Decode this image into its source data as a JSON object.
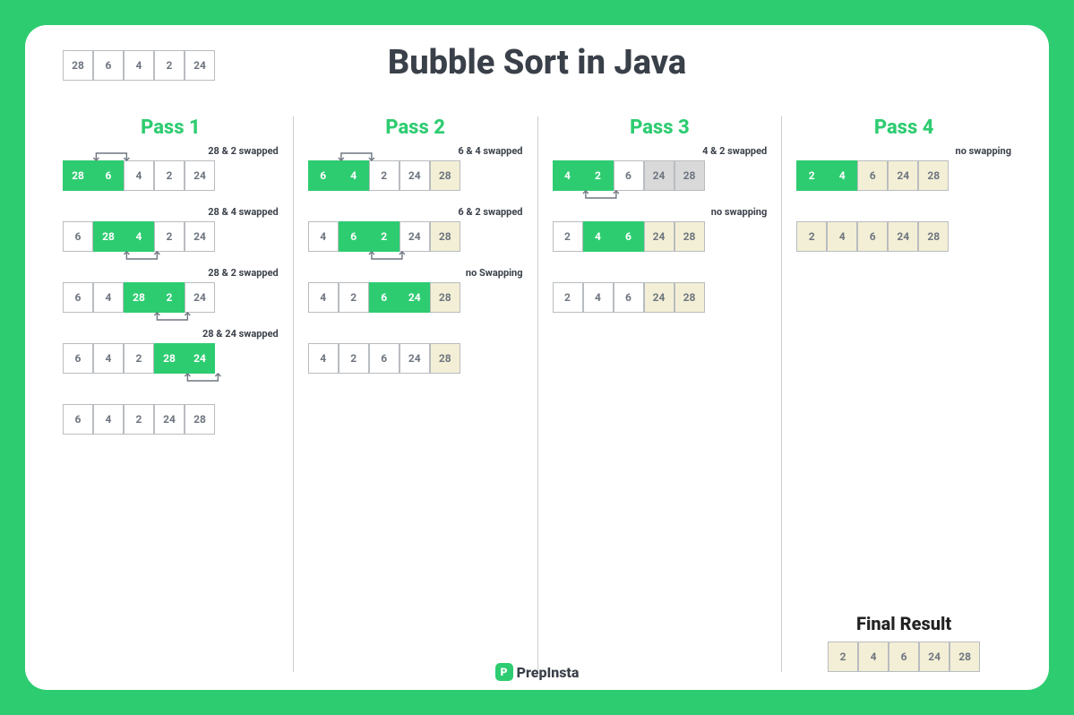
{
  "title": "Bubble Sort in Java",
  "brand": "PrepInsta",
  "colors": {
    "accent": "#2ecc71",
    "done": "#f3efd6",
    "gray": "#d9d9d9"
  },
  "initial": {
    "cells": [
      {
        "v": "28"
      },
      {
        "v": "6"
      },
      {
        "v": "4"
      },
      {
        "v": "2"
      },
      {
        "v": "24"
      }
    ]
  },
  "final_title": "Final Result",
  "final": {
    "cells": [
      {
        "v": "2",
        "s": "done"
      },
      {
        "v": "4",
        "s": "done"
      },
      {
        "v": "6",
        "s": "done"
      },
      {
        "v": "24",
        "s": "done"
      },
      {
        "v": "28",
        "s": "done"
      }
    ]
  },
  "passes": [
    {
      "title": "Pass 1",
      "steps": [
        {
          "label": "28 & 2 swapped",
          "cells": [
            {
              "v": "28",
              "s": "hl"
            },
            {
              "v": "6",
              "s": "hl"
            },
            {
              "v": "4"
            },
            {
              "v": "2"
            },
            {
              "v": "24"
            }
          ],
          "swap": [
            0,
            1
          ],
          "arrow": "top"
        },
        {
          "label": "28 & 4 swapped",
          "cells": [
            {
              "v": "6"
            },
            {
              "v": "28",
              "s": "hl"
            },
            {
              "v": "4",
              "s": "hl"
            },
            {
              "v": "2"
            },
            {
              "v": "24"
            }
          ],
          "swap": [
            1,
            2
          ],
          "arrow": "bottom"
        },
        {
          "label": "28 & 2 swapped",
          "cells": [
            {
              "v": "6"
            },
            {
              "v": "4"
            },
            {
              "v": "28",
              "s": "hl"
            },
            {
              "v": "2",
              "s": "hl"
            },
            {
              "v": "24"
            }
          ],
          "swap": [
            2,
            3
          ],
          "arrow": "bottom"
        },
        {
          "label": "28 & 24 swapped",
          "cells": [
            {
              "v": "6"
            },
            {
              "v": "4"
            },
            {
              "v": "2"
            },
            {
              "v": "28",
              "s": "hl"
            },
            {
              "v": "24",
              "s": "hl"
            }
          ],
          "swap": [
            3,
            4
          ],
          "arrow": "bottom"
        },
        {
          "label": "",
          "cells": [
            {
              "v": "6"
            },
            {
              "v": "4"
            },
            {
              "v": "2"
            },
            {
              "v": "24"
            },
            {
              "v": "28"
            }
          ]
        }
      ]
    },
    {
      "title": "Pass 2",
      "steps": [
        {
          "label": "6 & 4 swapped",
          "cells": [
            {
              "v": "6",
              "s": "hl"
            },
            {
              "v": "4",
              "s": "hl"
            },
            {
              "v": "2"
            },
            {
              "v": "24"
            },
            {
              "v": "28",
              "s": "done"
            }
          ],
          "swap": [
            0,
            1
          ],
          "arrow": "top"
        },
        {
          "label": "6 & 2 swapped",
          "cells": [
            {
              "v": "4"
            },
            {
              "v": "6",
              "s": "hl"
            },
            {
              "v": "2",
              "s": "hl"
            },
            {
              "v": "24"
            },
            {
              "v": "28",
              "s": "done"
            }
          ],
          "swap": [
            1,
            2
          ],
          "arrow": "bottom"
        },
        {
          "label": "no Swapping",
          "cells": [
            {
              "v": "4"
            },
            {
              "v": "2"
            },
            {
              "v": "6",
              "s": "hl"
            },
            {
              "v": "24",
              "s": "hl"
            },
            {
              "v": "28",
              "s": "done"
            }
          ]
        },
        {
          "label": "",
          "cells": [
            {
              "v": "4"
            },
            {
              "v": "2"
            },
            {
              "v": "6"
            },
            {
              "v": "24"
            },
            {
              "v": "28",
              "s": "done"
            }
          ]
        }
      ]
    },
    {
      "title": "Pass 3",
      "steps": [
        {
          "label": "4 & 2 swapped",
          "cells": [
            {
              "v": "4",
              "s": "hl"
            },
            {
              "v": "2",
              "s": "hl"
            },
            {
              "v": "6"
            },
            {
              "v": "24",
              "s": "gray"
            },
            {
              "v": "28",
              "s": "gray"
            }
          ],
          "swap": [
            0,
            1
          ],
          "arrow": "bottom"
        },
        {
          "label": "no swapping",
          "cells": [
            {
              "v": "2"
            },
            {
              "v": "4",
              "s": "hl"
            },
            {
              "v": "6",
              "s": "hl"
            },
            {
              "v": "24",
              "s": "done"
            },
            {
              "v": "28",
              "s": "done"
            }
          ]
        },
        {
          "label": "",
          "cells": [
            {
              "v": "2"
            },
            {
              "v": "4"
            },
            {
              "v": "6"
            },
            {
              "v": "24",
              "s": "done"
            },
            {
              "v": "28",
              "s": "done"
            }
          ]
        }
      ]
    },
    {
      "title": "Pass 4",
      "steps": [
        {
          "label": "no swapping",
          "cells": [
            {
              "v": "2",
              "s": "hl"
            },
            {
              "v": "4",
              "s": "hl"
            },
            {
              "v": "6",
              "s": "done"
            },
            {
              "v": "24",
              "s": "done"
            },
            {
              "v": "28",
              "s": "done"
            }
          ]
        },
        {
          "label": "",
          "cells": [
            {
              "v": "2",
              "s": "done"
            },
            {
              "v": "4",
              "s": "done"
            },
            {
              "v": "6",
              "s": "done"
            },
            {
              "v": "24",
              "s": "done"
            },
            {
              "v": "28",
              "s": "done"
            }
          ]
        }
      ],
      "show_final": true
    }
  ]
}
